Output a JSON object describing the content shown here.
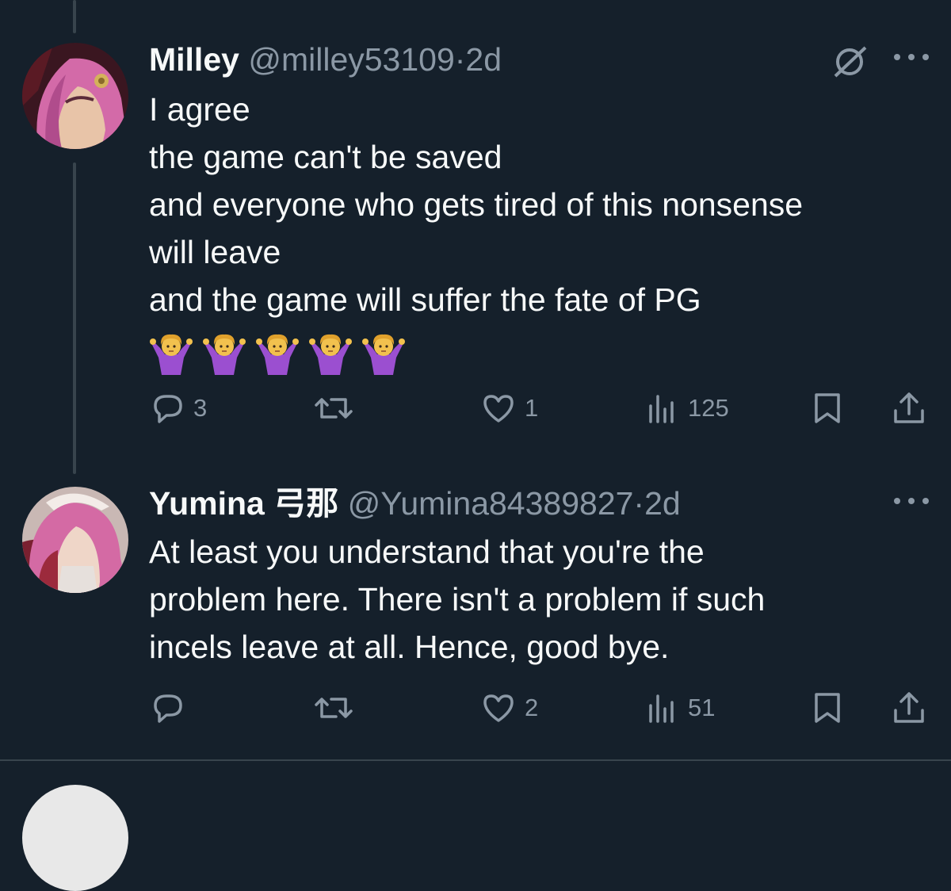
{
  "tweets": [
    {
      "name": "Milley",
      "handle": "@milley53109",
      "separator": "·",
      "time": "2d",
      "lines": [
        "I agree",
        "the game can't be saved",
        "and everyone who gets tired of this nonsense",
        "will leave",
        "and the game will suffer the fate of PG"
      ],
      "emojis": [
        "🤷‍♀️",
        "🤷‍♀️",
        "🤷‍♀️",
        "🤷‍♀️",
        "🤷‍♀️"
      ],
      "replies": "3",
      "retweets": "",
      "likes": "1",
      "views": "125"
    },
    {
      "name": "Yumina 弓那",
      "handle": "@Yumina84389827",
      "separator": "·",
      "time": "2d",
      "lines": [
        "At least you understand that you're the",
        "problem here. There isn't a problem if such",
        "incels leave at all. Hence, good bye."
      ],
      "replies": "",
      "retweets": "",
      "likes": "2",
      "views": "51"
    }
  ],
  "icons": {
    "mute": "no-symbol-icon",
    "more": "more-dots-icon",
    "reply": "reply-bubble-icon",
    "retweet": "retweet-icon",
    "like": "heart-icon",
    "views": "views-bars-icon",
    "bookmark": "bookmark-icon",
    "share": "share-upload-icon"
  },
  "colors": {
    "background": "#15202b",
    "text": "#f7f9f9",
    "secondary": "#8b98a5",
    "line": "#38444d"
  }
}
